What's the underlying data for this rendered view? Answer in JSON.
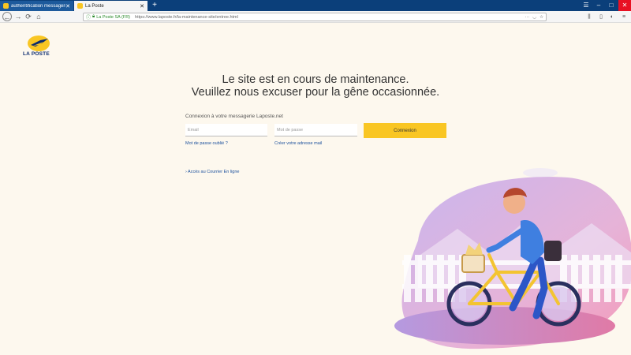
{
  "browser": {
    "tabs": [
      {
        "label": "authentification messagerie laPoste.net",
        "active": false
      },
      {
        "label": "La Poste",
        "active": true
      }
    ],
    "url": {
      "secure_label": "La Poste SA (FR)",
      "text": "https://www.laposte.fr/la-maintenance-site/entree.html"
    }
  },
  "page": {
    "logo_label": "LA POSTE",
    "title_line1": "Le site est en cours de maintenance.",
    "title_line2": "Veuillez nous excuser pour la gêne occasionnée.",
    "login": {
      "heading": "Connexion à votre messagerie Laposte.net",
      "email_placeholder": "Email",
      "password_placeholder": "Mot de passe",
      "button_label": "Connexion",
      "forgot_link": "Mot de passe oublié ?",
      "create_link": "Créer votre adresse mail",
      "access_link": "› Accès au Courrier En ligne"
    }
  },
  "colors": {
    "accent_yellow": "#f9c623",
    "link_blue": "#1a4f9c",
    "page_bg": "#fdf8ee",
    "tabbar": "#0b3f7a"
  }
}
